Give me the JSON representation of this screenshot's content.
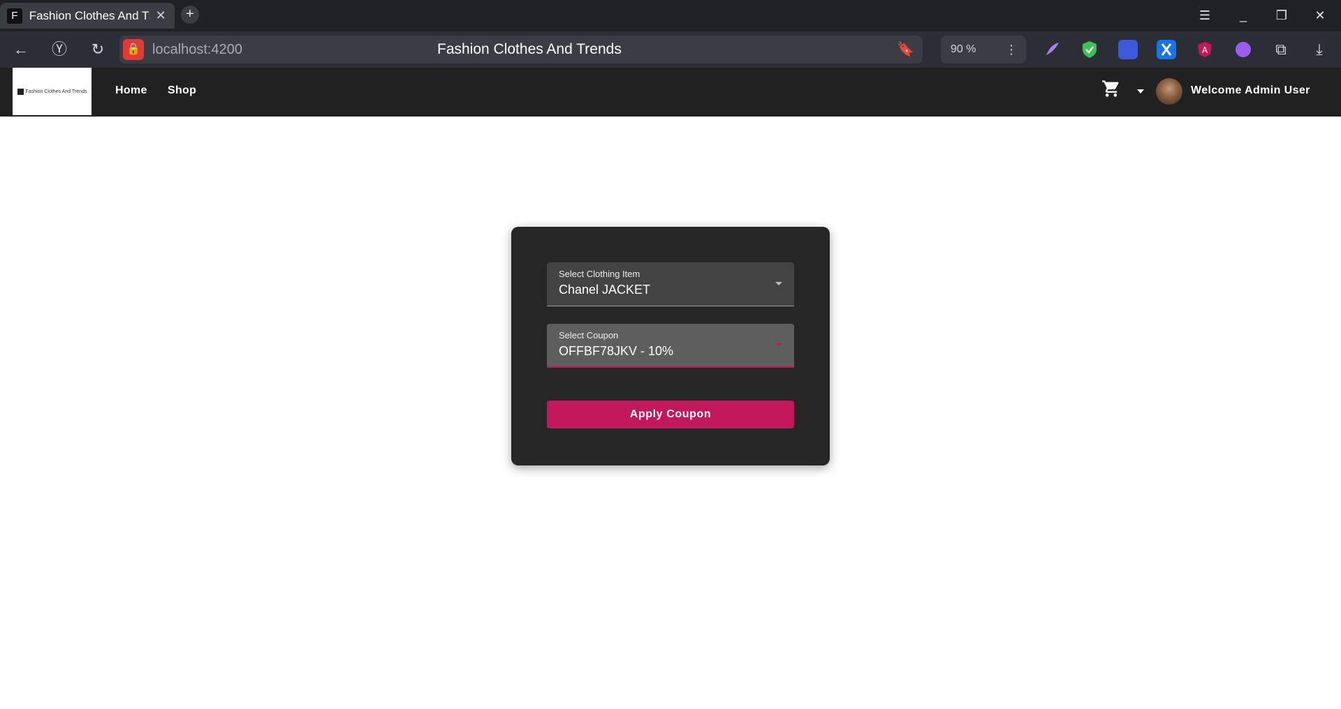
{
  "browser": {
    "tab_title": "Fashion Clothes And Trends",
    "tab_favicon_letter": "F",
    "url": "localhost:4200",
    "page_title": "Fashion Clothes And Trends",
    "zoom": "90 %",
    "icons": [
      "back-icon",
      "yandex-icon",
      "reload-icon",
      "bookmark-icon",
      "extensions-icon",
      "download-icon"
    ]
  },
  "navbar": {
    "logo_text": "Fashion Clothes And Trends",
    "links": [
      "Home",
      "Shop"
    ],
    "welcome": "Welcome Admin User"
  },
  "form": {
    "item_label": "Select Clothing Item",
    "item_value": "Chanel JACKET",
    "coupon_label": "Select Coupon",
    "coupon_value": "OFFBF78JKV - 10%",
    "apply_label": "Apply Coupon"
  },
  "colors": {
    "navbar": "#212121",
    "card": "#262626",
    "accent": "#c2185b"
  }
}
